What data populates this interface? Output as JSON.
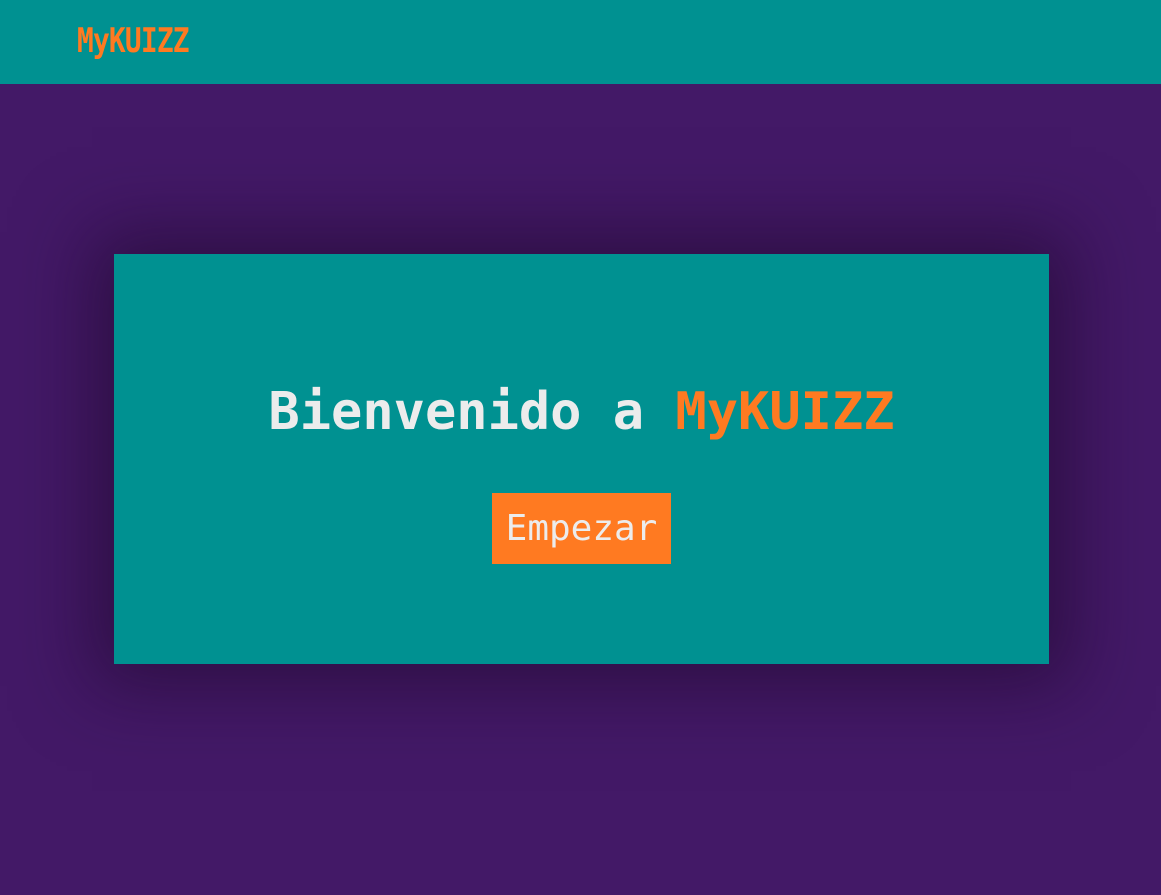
{
  "navbar": {
    "brand": "MyKUIZZ"
  },
  "hero": {
    "welcome_prefix": "Bienvenido a ",
    "welcome_brand": "MyKUIZZ",
    "start_label": "Empezar"
  },
  "colors": {
    "page_background": "#431967",
    "teal": "#009191",
    "accent_orange": "#ff7a21",
    "text_light": "#ececec"
  }
}
